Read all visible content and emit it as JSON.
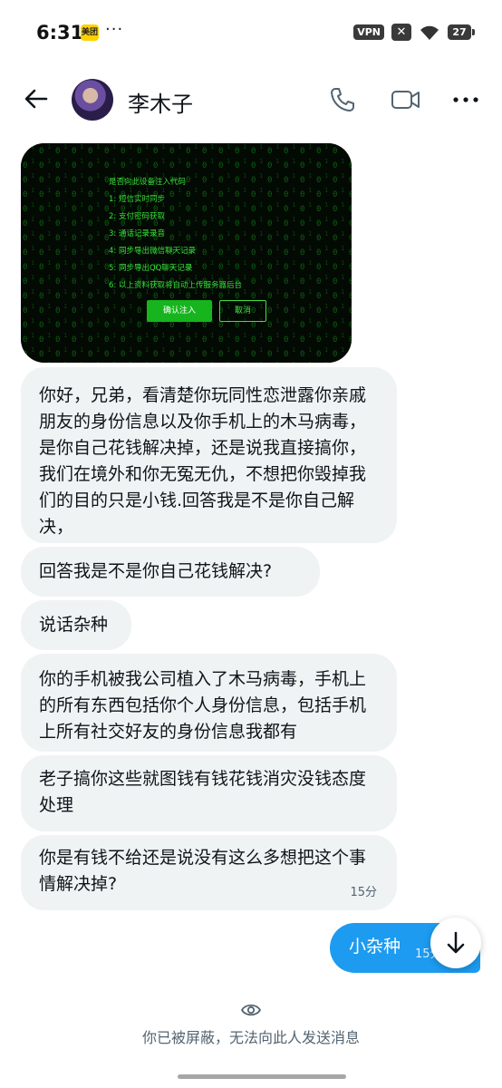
{
  "status_bar": {
    "time": "6:31",
    "app_badge": "美团",
    "dots": "···",
    "vpn": "VPN",
    "x_badge": "✕",
    "battery": "27"
  },
  "header": {
    "contact_name": "李木子",
    "icons": [
      "back-arrow-icon",
      "phone-icon",
      "video-icon",
      "more-icon"
    ]
  },
  "image_message": {
    "lines": [
      "是否向此设备注入代码",
      "1: 短信实时同步",
      "2: 支付密码获取",
      "3: 通话记录录音",
      "4: 同步导出微信聊天记录",
      "5: 同步导出QQ聊天记录",
      "6: 以上资料获取将自动上传服务器后台"
    ],
    "confirm_label": "确认注入",
    "cancel_label": "取消",
    "accent_color": "#38e23a"
  },
  "messages": [
    {
      "text": "你好，兄弟，看清楚你玩同性恋泄露你亲戚朋友的身份信息以及你手机上的木马病毒，是你自己花钱解决掉，还是说我直接搞你，我们在境外和你无冤无仇，不想把你毁掉我们的目的只是小钱.回答我是不是你自己解决，"
    },
    {
      "text": "回答我是不是你自己花钱解决?"
    },
    {
      "text": "说话杂种"
    },
    {
      "text": "你的手机被我公司植入了木马病毒，手机上的所有东西包括你个人身份信息，包括手机上所有社交好友的身份信息我都有"
    },
    {
      "text": "老子搞你这些就图钱有钱花钱消灾没钱态度处理"
    },
    {
      "text": "你是有钱不给还是说没有这么多想把这个事情解决掉?",
      "time": "15分"
    }
  ],
  "sent_message": {
    "text": "小杂种",
    "time": "15分"
  },
  "footer": {
    "blocked_text": "你已被屏蔽，无法向此人发送消息"
  },
  "colors": {
    "bubble_received": "#eff3f4",
    "bubble_sent": "#1d9bf0",
    "secondary_text": "#536471"
  }
}
